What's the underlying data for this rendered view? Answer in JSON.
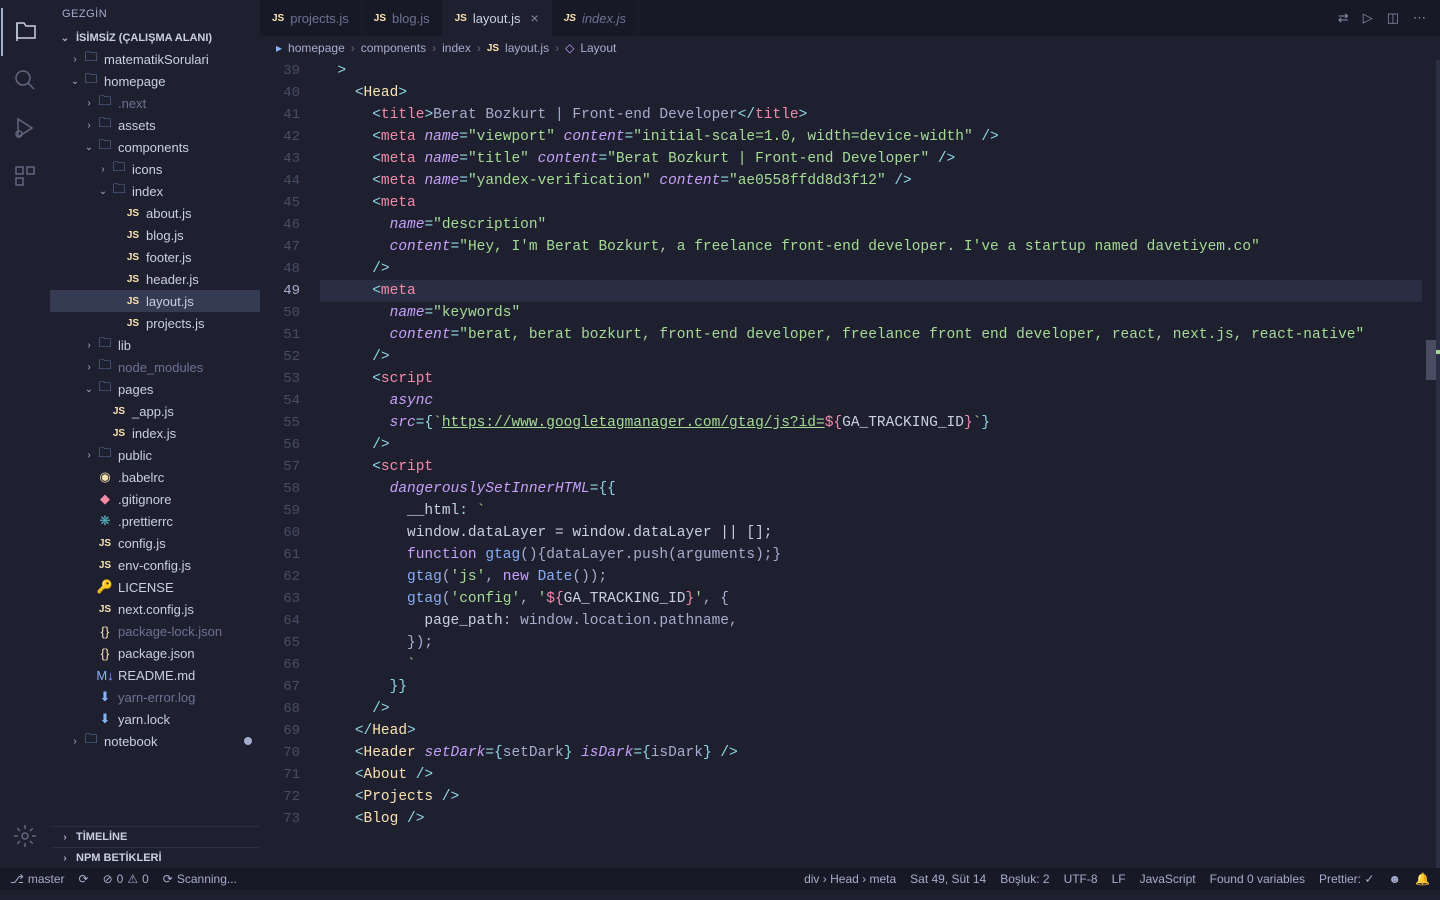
{
  "sidebar": {
    "title": "GEZGİN",
    "workspace": "İSİMSİZ (ÇALIŞMA ALANI)",
    "tree": [
      {
        "indent": 1,
        "chev": "›",
        "icon": "folder",
        "label": "matematikSorulari"
      },
      {
        "indent": 1,
        "chev": "⌄",
        "icon": "folder",
        "label": "homepage"
      },
      {
        "indent": 2,
        "chev": "›",
        "icon": "folder",
        "label": ".next",
        "dim": true
      },
      {
        "indent": 2,
        "chev": "›",
        "icon": "folder",
        "label": "assets"
      },
      {
        "indent": 2,
        "chev": "⌄",
        "icon": "folder",
        "label": "components"
      },
      {
        "indent": 3,
        "chev": "›",
        "icon": "folder",
        "label": "icons"
      },
      {
        "indent": 3,
        "chev": "⌄",
        "icon": "folder",
        "label": "index"
      },
      {
        "indent": 4,
        "chev": "",
        "icon": "js",
        "label": "about.js"
      },
      {
        "indent": 4,
        "chev": "",
        "icon": "js",
        "label": "blog.js"
      },
      {
        "indent": 4,
        "chev": "",
        "icon": "js",
        "label": "footer.js"
      },
      {
        "indent": 4,
        "chev": "",
        "icon": "js",
        "label": "header.js"
      },
      {
        "indent": 4,
        "chev": "",
        "icon": "js",
        "label": "layout.js",
        "active": true
      },
      {
        "indent": 4,
        "chev": "",
        "icon": "js",
        "label": "projects.js"
      },
      {
        "indent": 2,
        "chev": "›",
        "icon": "folder",
        "label": "lib"
      },
      {
        "indent": 2,
        "chev": "›",
        "icon": "folder",
        "label": "node_modules",
        "dim": true
      },
      {
        "indent": 2,
        "chev": "⌄",
        "icon": "folder",
        "label": "pages"
      },
      {
        "indent": 3,
        "chev": "",
        "icon": "js",
        "label": "_app.js"
      },
      {
        "indent": 3,
        "chev": "",
        "icon": "js",
        "label": "index.js"
      },
      {
        "indent": 2,
        "chev": "›",
        "icon": "folder",
        "label": "public"
      },
      {
        "indent": 2,
        "chev": "",
        "icon": "babel",
        "label": ".babelrc"
      },
      {
        "indent": 2,
        "chev": "",
        "icon": "git",
        "label": ".gitignore"
      },
      {
        "indent": 2,
        "chev": "",
        "icon": "prettier",
        "label": ".prettierrc"
      },
      {
        "indent": 2,
        "chev": "",
        "icon": "js",
        "label": "config.js"
      },
      {
        "indent": 2,
        "chev": "",
        "icon": "js",
        "label": "env-config.js"
      },
      {
        "indent": 2,
        "chev": "",
        "icon": "license",
        "label": "LICENSE"
      },
      {
        "indent": 2,
        "chev": "",
        "icon": "js",
        "label": "next.config.js"
      },
      {
        "indent": 2,
        "chev": "",
        "icon": "json",
        "label": "package-lock.json",
        "dim": true
      },
      {
        "indent": 2,
        "chev": "",
        "icon": "json",
        "label": "package.json"
      },
      {
        "indent": 2,
        "chev": "",
        "icon": "md",
        "label": "README.md"
      },
      {
        "indent": 2,
        "chev": "",
        "icon": "yarn",
        "label": "yarn-error.log",
        "dim": true
      },
      {
        "indent": 2,
        "chev": "",
        "icon": "yarn",
        "label": "yarn.lock"
      },
      {
        "indent": 1,
        "chev": "›",
        "icon": "folder",
        "label": "notebook",
        "dirty": true
      }
    ],
    "sections": [
      "TİMELİNE",
      "NPM BETİKLERİ"
    ]
  },
  "tabs": [
    {
      "label": "projects.js",
      "icon": "js"
    },
    {
      "label": "blog.js",
      "icon": "js"
    },
    {
      "label": "layout.js",
      "icon": "js",
      "active": true,
      "close": true
    },
    {
      "label": "index.js",
      "icon": "js",
      "italic": true
    }
  ],
  "breadcrumb": [
    "homepage",
    "components",
    "index",
    "layout.js",
    "Layout"
  ],
  "lineStart": 39,
  "lineEnd": 73,
  "currentLine": 49,
  "code": {
    "title": "Berat Bozkurt | Front-end Developer",
    "viewport": "initial-scale=1.0, width=device-width",
    "titleMetaContent": "Berat Bozkurt | Front-end Developer",
    "yandex": "ae0558ffdd8d3f12",
    "desc": "Hey, I'm Berat Bozkurt, a freelance front-end developer. I've a startup named davetiyem.co",
    "keywords": "berat, berat bozkurt, front-end developer, freelance front end developer, react, next.js, react-native",
    "gtagUrl": "https://www.googletagmanager.com/gtag/js?id=",
    "gaTracking": "GA_TRACKING_ID"
  },
  "statusbar": {
    "branch": "master",
    "sync": "⟳",
    "errors": "0",
    "warnings": "0",
    "scanning": "Scanning...",
    "breadcrumbPath": "div › Head › meta",
    "pos": "Sat 49, Süt 14",
    "spaces": "Boşluk: 2",
    "encoding": "UTF-8",
    "eol": "LF",
    "lang": "JavaScript",
    "vars": "Found 0 variables",
    "prettier": "Prettier: ✓"
  }
}
